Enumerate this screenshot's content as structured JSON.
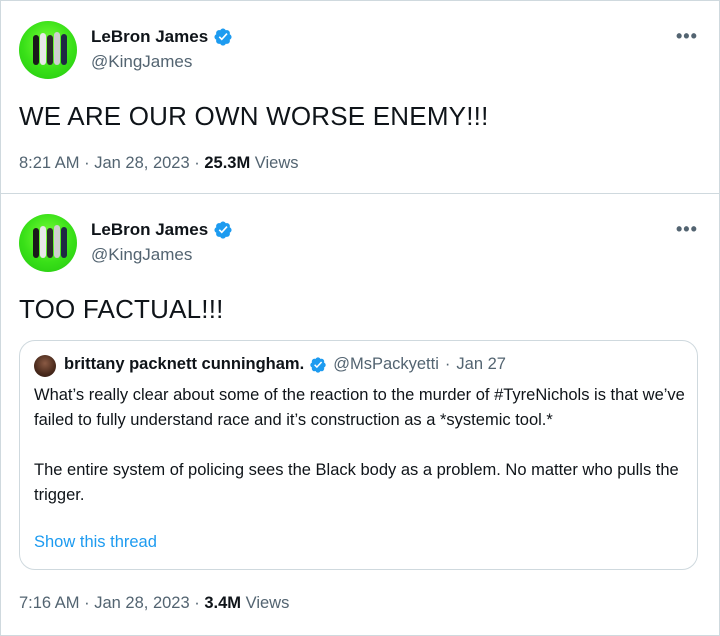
{
  "tweets": [
    {
      "author": {
        "name": "LeBron James",
        "handle": "@KingJames",
        "verified": true
      },
      "text": "WE ARE OUR OWN WORSE ENEMY!!!",
      "time": "8:21 AM",
      "date": "Jan 28, 2023",
      "views_count": "25.3M",
      "views_label": "Views",
      "more_icon": "more-horizontal-icon"
    },
    {
      "author": {
        "name": "LeBron James",
        "handle": "@KingJames",
        "verified": true
      },
      "text": "TOO FACTUAL!!!",
      "time": "7:16 AM",
      "date": "Jan 28, 2023",
      "views_count": "3.4M",
      "views_label": "Views",
      "more_icon": "more-horizontal-icon",
      "quoted": {
        "author": {
          "name": "brittany packnett cunningham.",
          "handle": "@MsPackyetti",
          "verified": true
        },
        "date": "Jan 27",
        "paragraphs": [
          "What’s really clear about some of the reaction to the murder of #TyreNichols is that we’ve failed to fully understand race and it’s construction as a *systemic tool.*",
          "The entire system of policing sees the Black body as a problem. No matter who pulls the trigger."
        ],
        "show_thread": "Show this thread"
      }
    }
  ],
  "colors": {
    "verified": "#1d9bf0",
    "link": "#1d9bf0",
    "secondary_text": "#536471",
    "border": "#cfd9de"
  }
}
